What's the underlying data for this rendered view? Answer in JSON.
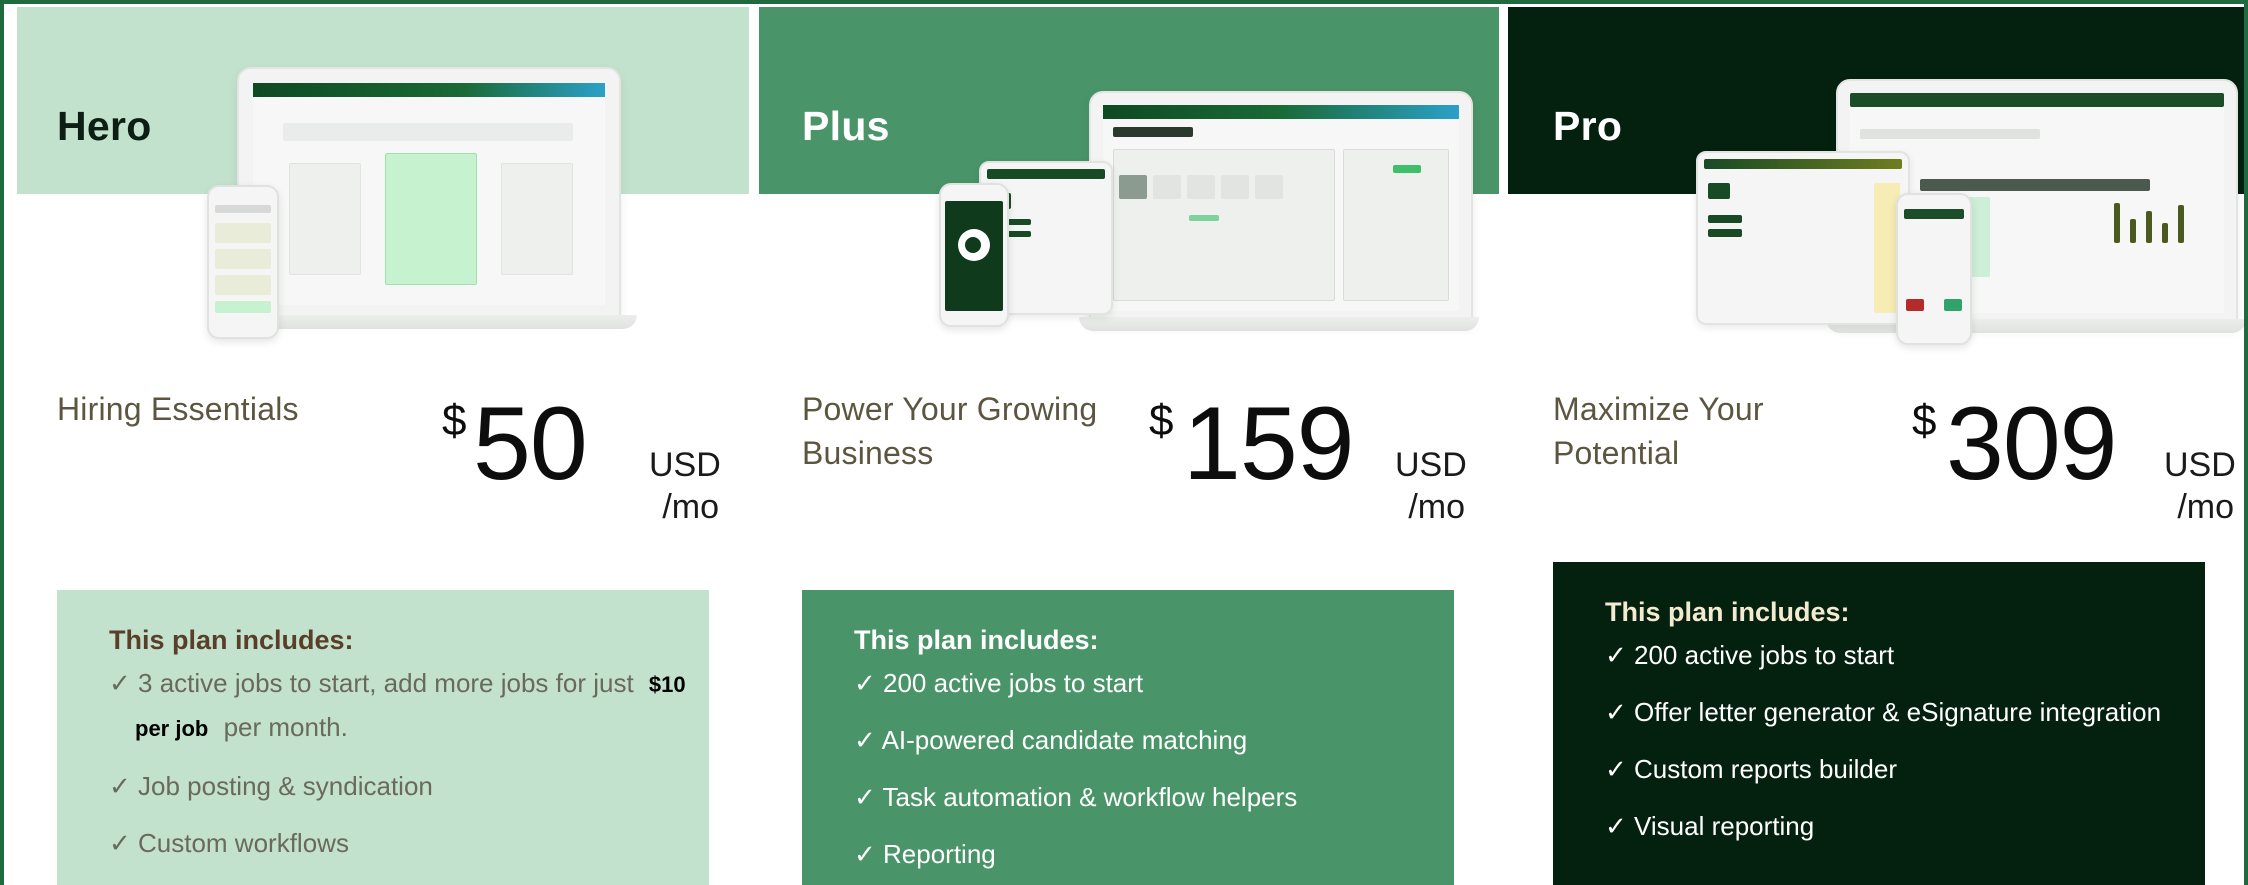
{
  "plans": [
    {
      "name": "Hero",
      "tagline": "Hiring Essentials",
      "currency_symbol": "$",
      "price": "50",
      "currency": "USD",
      "period": "/mo",
      "includes_title": "This plan includes:",
      "feature_1_pre": "✓ 3 active jobs to start, add more jobs for just",
      "feature_1_highlight": "$10 per job",
      "feature_1_post": "per month.",
      "feature_2": "✓ Job posting & syndication",
      "feature_3": "✓ Custom workflows"
    },
    {
      "name": "Plus",
      "tagline": "Power Your Growing Business",
      "currency_symbol": "$",
      "price": "159",
      "currency": "USD",
      "period": "/mo",
      "includes_title": "This plan includes:",
      "feature_1": "✓ 200 active jobs to start",
      "feature_2": "✓ AI-powered candidate matching",
      "feature_3": "✓ Task automation & workflow helpers",
      "feature_4": "✓ Reporting"
    },
    {
      "name": "Pro",
      "tagline": "Maximize Your Potential",
      "currency_symbol": "$",
      "price": "309",
      "currency": "USD",
      "period": "/mo",
      "includes_title": "This plan includes:",
      "feature_1": "✓ 200 active jobs to start",
      "feature_2": "✓ Offer letter generator & eSignature integration",
      "feature_3": "✓ Custom reports builder",
      "feature_4": "✓ Visual reporting"
    }
  ],
  "colors": {
    "hero_band": "#c3e2cd",
    "plus_band": "#4a9469",
    "pro_band": "#04200f",
    "frame_border": "#1f6a3f"
  },
  "images": {
    "hero": "device-mockup-laptop-phone",
    "plus": "device-mockup-laptop-tablet-phone",
    "pro": "device-mockup-laptop-tablet-phone"
  }
}
